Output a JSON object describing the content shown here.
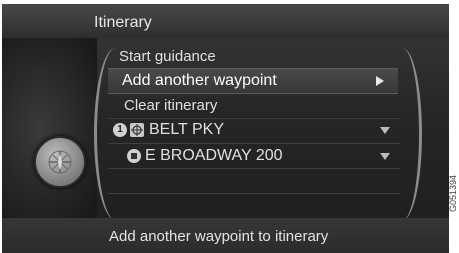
{
  "header": {
    "title": "Itinerary"
  },
  "menu": {
    "start_guidance": "Start guidance",
    "add_waypoint": "Add another waypoint",
    "clear_itinerary": "Clear itinerary"
  },
  "waypoints": [
    {
      "badge": "1",
      "name": "BELT PKY"
    },
    {
      "name": "E BROADWAY 200"
    }
  ],
  "status": {
    "text": "Add another waypoint to itinerary"
  },
  "figure_ref": "G051394"
}
